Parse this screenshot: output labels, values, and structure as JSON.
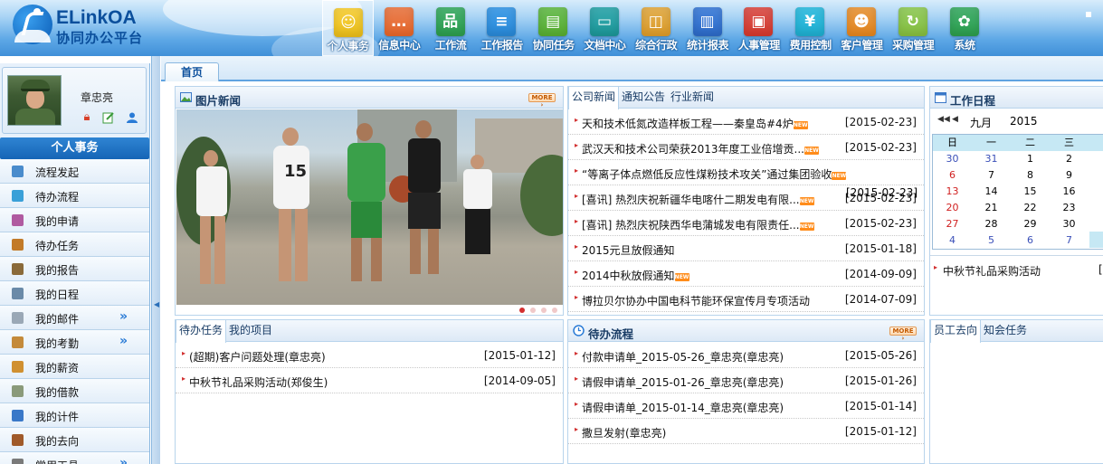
{
  "logo": {
    "en": "ELinkOA",
    "cn": "协同办公平台"
  },
  "topnav": [
    {
      "label": "个人事务",
      "icon": "person-icon",
      "color": "#f5c518",
      "glyph": "☺",
      "active": true
    },
    {
      "label": "信息中心",
      "icon": "chat-icon",
      "color": "#f26a2a",
      "glyph": "…"
    },
    {
      "label": "工作流",
      "icon": "workflow-icon",
      "color": "#2ea44f",
      "glyph": "品"
    },
    {
      "label": "工作报告",
      "icon": "report-icon",
      "color": "#2a8ee0",
      "glyph": "≡"
    },
    {
      "label": "协同任务",
      "icon": "task-icon",
      "color": "#5cb531",
      "glyph": "▤"
    },
    {
      "label": "文档中心",
      "icon": "folder-icon",
      "color": "#1d9d9d",
      "glyph": "▭"
    },
    {
      "label": "综合行政",
      "icon": "admin-icon",
      "color": "#e8a229",
      "glyph": "◫"
    },
    {
      "label": "统计报表",
      "icon": "chart-icon",
      "color": "#2f6fd0",
      "glyph": "▥"
    },
    {
      "label": "人事管理",
      "icon": "hr-icon",
      "color": "#e03a2d",
      "glyph": "▣"
    },
    {
      "label": "费用控制",
      "icon": "yen-icon",
      "color": "#1fb6d8",
      "glyph": "¥"
    },
    {
      "label": "客户管理",
      "icon": "customer-icon",
      "color": "#f08b1d",
      "glyph": "☻"
    },
    {
      "label": "采购管理",
      "icon": "purchase-icon",
      "color": "#8cc63f",
      "glyph": "↻"
    },
    {
      "label": "系统",
      "icon": "gear-icon",
      "color": "#2ea44f",
      "glyph": "✿"
    }
  ],
  "user": {
    "name": "章忠亮"
  },
  "menu_title": "个人事务",
  "menu": [
    {
      "label": "流程发起",
      "icon": "flow-start-icon",
      "color": "#4a8ccc",
      "more": ""
    },
    {
      "label": "待办流程",
      "icon": "pending-flow-icon",
      "color": "#3aa0d8",
      "more": ""
    },
    {
      "label": "我的申请",
      "icon": "apply-icon",
      "color": "#b05aa0",
      "more": ""
    },
    {
      "label": "待办任务",
      "icon": "pending-task-icon",
      "color": "#c27a28",
      "more": ""
    },
    {
      "label": "我的报告",
      "icon": "my-report-icon",
      "color": "#8a6a3a",
      "more": ""
    },
    {
      "label": "我的日程",
      "icon": "schedule-icon",
      "color": "#6a8aa8",
      "more": ""
    },
    {
      "label": "我的邮件",
      "icon": "mail-icon",
      "color": "#9aa8b6",
      "more": "»"
    },
    {
      "label": "我的考勤",
      "icon": "attendance-icon",
      "color": "#c48a3a",
      "more": "»"
    },
    {
      "label": "我的薪资",
      "icon": "salary-icon",
      "color": "#d09030",
      "more": ""
    },
    {
      "label": "我的借款",
      "icon": "loan-icon",
      "color": "#8a9a7a",
      "more": ""
    },
    {
      "label": "我的计件",
      "icon": "piecework-icon",
      "color": "#3a78c8",
      "more": ""
    },
    {
      "label": "我的去向",
      "icon": "whereabouts-icon",
      "color": "#a05a2a",
      "more": ""
    },
    {
      "label": "常用工具",
      "icon": "tools-icon",
      "color": "#7a7a7a",
      "more": "»"
    }
  ],
  "tabs": {
    "home": "首页"
  },
  "photo_news": {
    "title": "图片新闻",
    "more": "MORE ›"
  },
  "company_news": {
    "tabs": [
      "公司新闻",
      "通知公告",
      "行业新闻"
    ],
    "items": [
      {
        "title": "天和技术低氮改造样板工程——秦皇岛#4炉",
        "new": true,
        "date": "[2015-02-23]"
      },
      {
        "title": "武汉天和技术公司荣获2013年度工业倍增贡...",
        "new": true,
        "date": "[2015-02-23]"
      },
      {
        "title": "“等离子体点燃低反应性煤粉技术攻关”通过集团验收",
        "new": true,
        "date": ""
      },
      {
        "title": "[喜讯] 热烈庆祝新疆华电喀什二期发电有限...",
        "new": true,
        "date": "[2015-02-23]"
      },
      {
        "title": "[喜讯] 热烈庆祝陕西华电蒲城发电有限责任...",
        "new": true,
        "date": "[2015-02-23]"
      },
      {
        "title": "2015元旦放假通知",
        "new": false,
        "date": "[2015-01-18]"
      },
      {
        "title": "2014中秋放假通知",
        "new": true,
        "date": "[2014-09-09]"
      },
      {
        "title": "博拉贝尔协办中国电科节能环保宣传月专项活动",
        "new": false,
        "date": "[2014-07-09]"
      }
    ],
    "overlap_date": "[2015-02-23]"
  },
  "schedule": {
    "title": "工作日程",
    "month": "九月",
    "year": "2015",
    "weekdays": [
      "日",
      "一",
      "二",
      "三"
    ],
    "weeks": [
      [
        "30",
        "31",
        "1",
        "2"
      ],
      [
        "6",
        "7",
        "8",
        "9"
      ],
      [
        "13",
        "14",
        "15",
        "16"
      ],
      [
        "20",
        "21",
        "22",
        "23"
      ],
      [
        "27",
        "28",
        "29",
        "30"
      ],
      [
        "4",
        "5",
        "6",
        "7"
      ]
    ],
    "events": [
      {
        "title": "中秋节礼品采购活动",
        "date": "["
      }
    ]
  },
  "pending_tasks": {
    "tabs": [
      "待办任务",
      "我的项目"
    ],
    "items": [
      {
        "title": "(超期)客户问题处理(章忠亮)",
        "date": "[2015-01-12]"
      },
      {
        "title": "中秋节礼品采购活动(郑俊生)",
        "date": "[2014-09-05]"
      }
    ]
  },
  "pending_flow": {
    "title": "待办流程",
    "more": "MORE ›",
    "items": [
      {
        "title": "付款申请单_2015-05-26_章忠亮(章忠亮)",
        "date": "[2015-05-26]"
      },
      {
        "title": "请假申请单_2015-01-26_章忠亮(章忠亮)",
        "date": "[2015-01-26]"
      },
      {
        "title": "请假申请单_2015-01-14_章忠亮(章忠亮)",
        "date": "[2015-01-14]"
      },
      {
        "title": "撒旦发射(章忠亮)",
        "date": "[2015-01-12]"
      }
    ]
  },
  "staff": {
    "tabs": [
      "员工去向",
      "知会任务"
    ]
  }
}
